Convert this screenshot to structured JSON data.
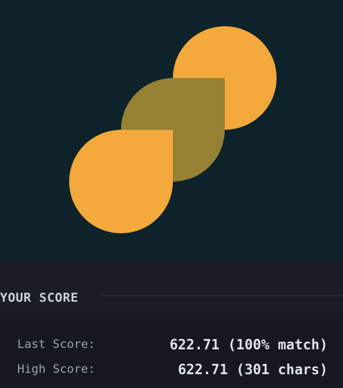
{
  "colors": {
    "stage_background": "#0d2329",
    "shape_orange": "#f3a93b",
    "shape_olive": "#958034",
    "panel_background": "#1a1d24",
    "text_primary": "#dfe4ea",
    "text_secondary": "#9aa3b0"
  },
  "preview": {
    "shapes": [
      "orange-circle",
      "olive-teardrop",
      "orange-teardrop"
    ]
  },
  "score": {
    "title": "YOUR SCORE",
    "last_label": "Last Score:",
    "last_value": "622.71 (100% match)",
    "high_label": "High Score:",
    "high_value": "622.71 (301 chars)"
  }
}
